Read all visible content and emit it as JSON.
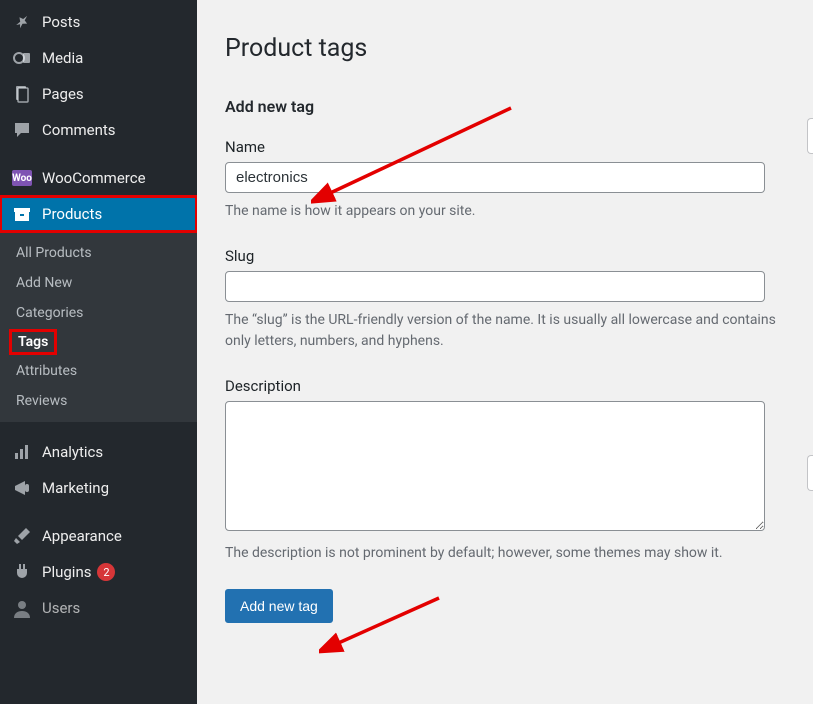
{
  "sidebar": {
    "items": [
      {
        "label": "Posts",
        "icon": "pin"
      },
      {
        "label": "Media",
        "icon": "media"
      },
      {
        "label": "Pages",
        "icon": "page"
      },
      {
        "label": "Comments",
        "icon": "comment"
      }
    ],
    "woo_label": "WooCommerce",
    "products_label": "Products",
    "sub": [
      {
        "label": "All Products"
      },
      {
        "label": "Add New"
      },
      {
        "label": "Categories"
      },
      {
        "label": "Tags",
        "current": true
      },
      {
        "label": "Attributes"
      },
      {
        "label": "Reviews"
      }
    ],
    "items2": [
      {
        "label": "Analytics",
        "icon": "analytics"
      },
      {
        "label": "Marketing",
        "icon": "marketing"
      }
    ],
    "items3": [
      {
        "label": "Appearance",
        "icon": "brush"
      },
      {
        "label": "Plugins",
        "icon": "plug",
        "count": "2"
      },
      {
        "label": "Users",
        "icon": "user"
      }
    ]
  },
  "page": {
    "title": "Product tags",
    "section": "Add new tag",
    "name_label": "Name",
    "name_value": "electronics",
    "name_hint": "The name is how it appears on your site.",
    "slug_label": "Slug",
    "slug_value": "",
    "slug_hint": "The “slug” is the URL-friendly version of the name. It is usually all lowercase and contains only letters, numbers, and hyphens.",
    "desc_label": "Description",
    "desc_value": "",
    "desc_hint": "The description is not prominent by default; however, some themes may show it.",
    "submit": "Add new tag"
  },
  "woo_badge": "Woo"
}
